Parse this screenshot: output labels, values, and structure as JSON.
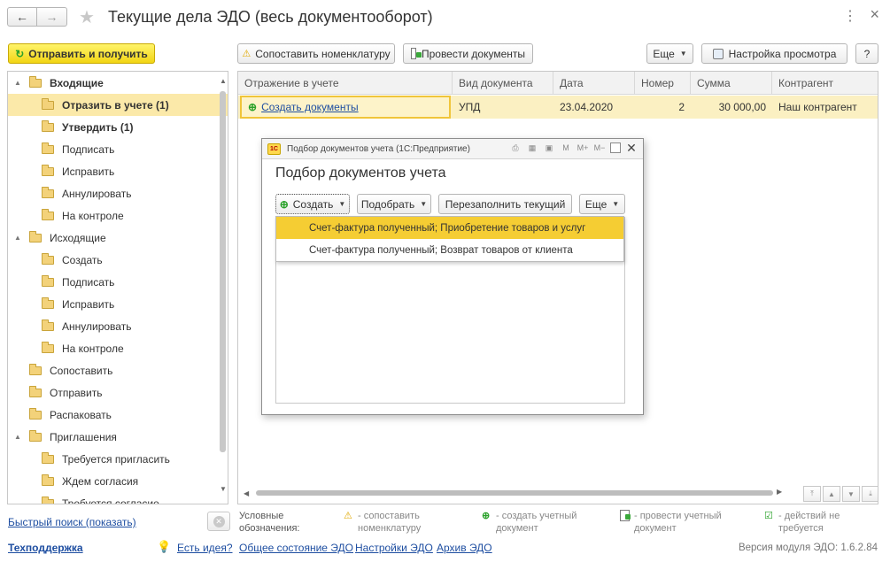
{
  "window": {
    "title": "Текущие дела ЭДО (весь документооборот)",
    "back_icon": "arrow-left",
    "forward_icon": "arrow-right",
    "more_glyph": "⋮",
    "close_glyph": "×"
  },
  "toolbar": {
    "send_receive": "Отправить и получить",
    "match_nomenclature": "Сопоставить номенклатуру",
    "post_documents": "Провести документы",
    "more": "Еще",
    "view_settings": "Настройка просмотра",
    "help": "?"
  },
  "sidebar": {
    "items": [
      {
        "label": "Входящие"
      },
      {
        "label": "Отразить в учете (1)"
      },
      {
        "label": "Утвердить (1)"
      },
      {
        "label": "Подписать"
      },
      {
        "label": "Исправить"
      },
      {
        "label": "Аннулировать"
      },
      {
        "label": "На контроле"
      },
      {
        "label": "Исходящие"
      },
      {
        "label": "Создать"
      },
      {
        "label": "Подписать"
      },
      {
        "label": "Исправить"
      },
      {
        "label": "Аннулировать"
      },
      {
        "label": "На контроле"
      },
      {
        "label": "Сопоставить"
      },
      {
        "label": "Отправить"
      },
      {
        "label": "Распаковать"
      },
      {
        "label": "Приглашения"
      },
      {
        "label": "Требуется пригласить"
      },
      {
        "label": "Ждем согласия"
      },
      {
        "label": "Требуется согласие"
      }
    ]
  },
  "grid": {
    "columns": [
      "Отражение в учете",
      "Вид документа",
      "Дата",
      "Номер",
      "Сумма",
      "Контрагент"
    ],
    "rows": [
      {
        "action": "Создать документы",
        "doc_type": "УПД",
        "date": "23.04.2020",
        "number": "2",
        "sum": "30 000,00",
        "counterparty": "Наш контрагент"
      }
    ]
  },
  "dialog": {
    "window_title": "Подбор документов учета  (1С:Предприятие)",
    "logo_text": "1С",
    "heading": "Подбор документов учета",
    "tool_icons": [
      "M",
      "M+",
      "M−"
    ],
    "buttons": {
      "create": "Создать",
      "pick": "Подобрать",
      "refill": "Перезаполнить текущий",
      "more": "Еще"
    },
    "dropdown": [
      "Счет-фактура полученный; Приобретение товаров и услуг",
      "Счет-фактура полученный; Возврат товаров от клиента"
    ]
  },
  "legend": {
    "label_line1": "Условные",
    "label_line2": "обозначения:",
    "items": [
      {
        "line1": "- сопоставить",
        "line2": "номенклатуру"
      },
      {
        "line1": "- создать учетный",
        "line2": "документ"
      },
      {
        "line1": "- провести учетный",
        "line2": "документ"
      },
      {
        "line1": "- действий не",
        "line2": "требуется"
      }
    ]
  },
  "quick_search": "Быстрый поиск (показать)",
  "footer": {
    "support": "Техподдержка",
    "idea": "Есть идея?",
    "general_status": "Общее состояние ЭДО",
    "settings": "Настройки ЭДО",
    "archive": "Архив ЭДО",
    "version": "Версия модуля ЭДО: 1.6.2.84"
  },
  "colors": {
    "accent_yellow": "#f5cd33",
    "selected_row": "#fbe9a9",
    "link": "#1e4ea1",
    "create_green": "#2aa12a"
  }
}
